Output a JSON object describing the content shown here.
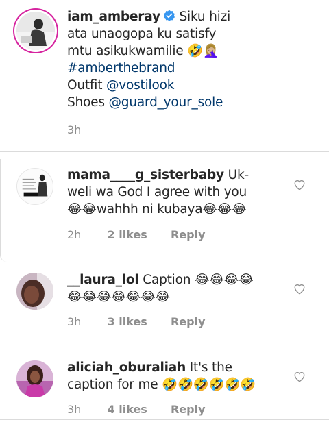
{
  "post_caption": {
    "username": "iam_amberay",
    "line1": "Siku hizi",
    "line2": "ata unaogopa ku satisfy",
    "line3": "mtu asikukwamilie 🤣🤦🏼‍♀️",
    "hashtag": "#amberthebrand",
    "outfit_label": "Outfit ",
    "outfit_handle": "@vostilook",
    "shoes_label": "Shoes ",
    "shoes_handle": "@guard_your_sole",
    "time": "3h"
  },
  "comments": [
    {
      "username": "mama____g_sisterbaby",
      "text_l1": " Uk-",
      "text_l2": "weli wa God I agree with you",
      "text_l3": "😂😂wahhh ni kubaya😂😂😂",
      "time": "2h",
      "likes": "2 likes",
      "reply": "Reply",
      "avatar_text": "YOU CAN!"
    },
    {
      "username": "__laura_lol",
      "text_l1": " Caption 😂😂😂😂",
      "text_l2": "😂😂😂😂😂😂😂",
      "time": "3h",
      "likes": "3 likes",
      "reply": "Reply"
    },
    {
      "username": "aliciah_oburaliah",
      "text_l1": " It's the",
      "text_l2": "caption for me 🤣🤣🤣🤣🤣🤣",
      "time": "3h",
      "likes": "4 likes",
      "reply": "Reply"
    }
  ],
  "colors": {
    "text": "#262626",
    "link": "#00376b",
    "meta": "#8e8e8e",
    "divider": "#dbdbdb",
    "verified": "#3897f0"
  }
}
